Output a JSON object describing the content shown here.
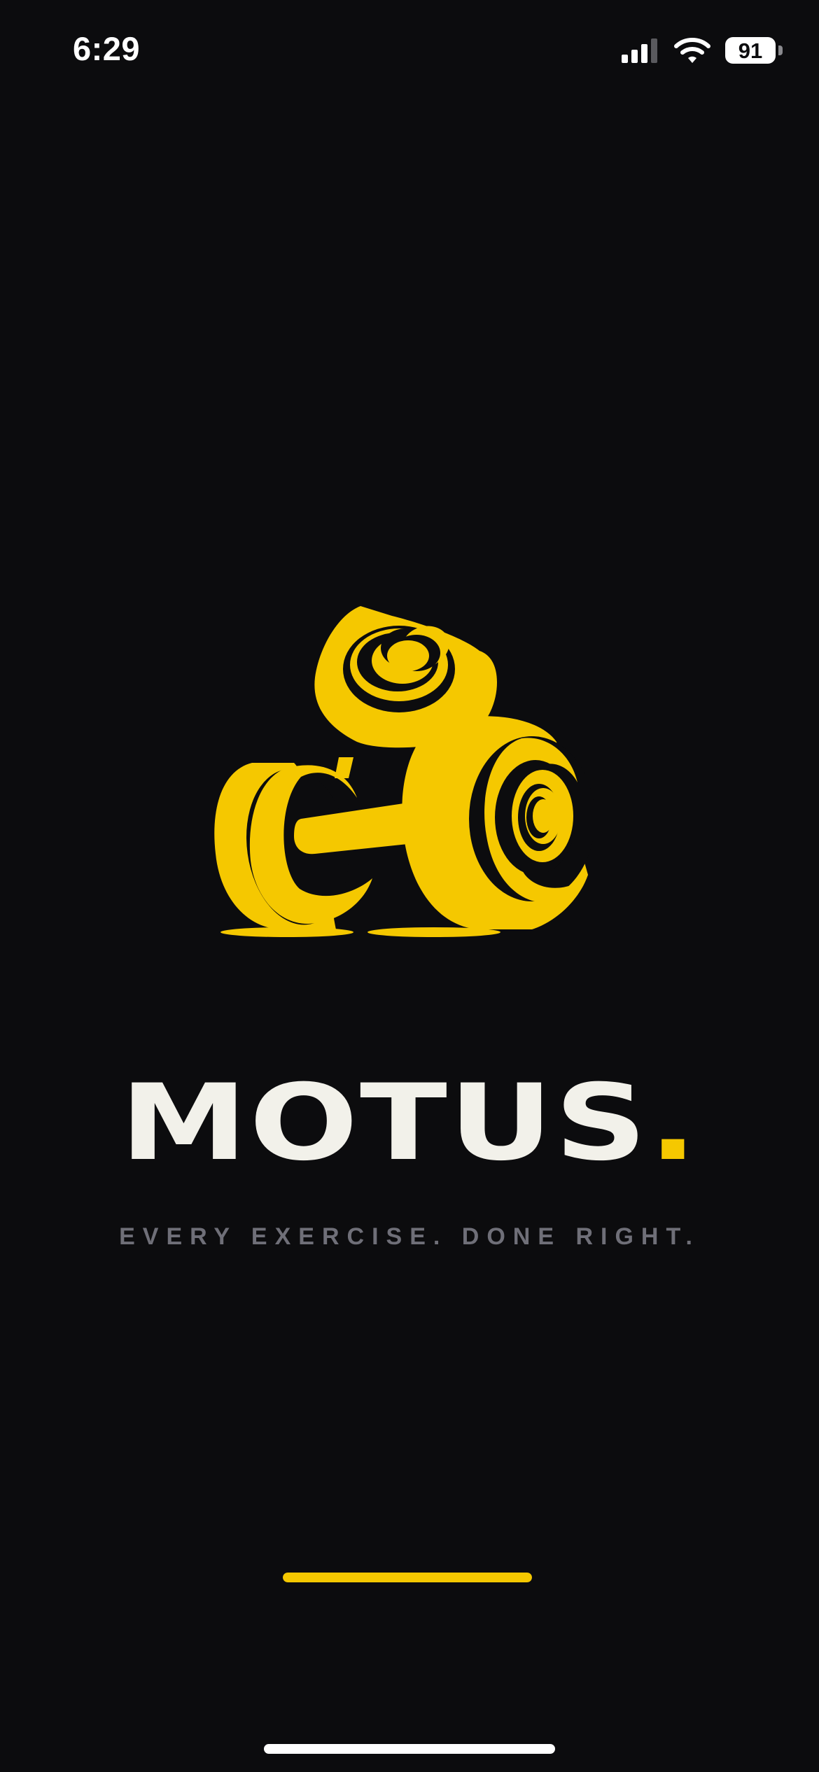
{
  "status_bar": {
    "time": "6:29",
    "battery_level": "91",
    "signal_icon": "cellular-signal-icon",
    "wifi_icon": "wifi-icon"
  },
  "logo": {
    "icon": "dumbbells-logo-icon"
  },
  "brand": {
    "name": "MOTUS",
    "dot": "."
  },
  "tagline": "EVERY EXERCISE. DONE RIGHT.",
  "loading": {
    "progress": 1.0
  },
  "colors": {
    "background": "#0c0c0e",
    "accent": "#f5c800",
    "wordmark": "#f2f1ea",
    "tagline": "#6f6f78"
  }
}
